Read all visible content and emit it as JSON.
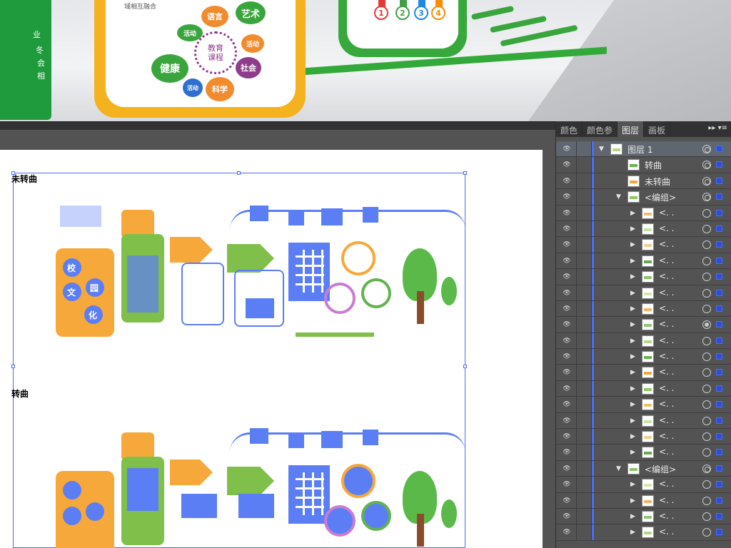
{
  "render": {
    "side_chars": [
      "业",
      "冬",
      "会",
      "相"
    ],
    "bubbles": {
      "center": "教育\n课程",
      "language": "语言",
      "art": "艺术",
      "activity_1": "活动",
      "activity_2": "活动",
      "activity_3": "活动",
      "health": "健康",
      "society": "社会",
      "science": "科学"
    },
    "panel_caption": "域相互融合",
    "numbers": [
      "1",
      "2",
      "3",
      "4"
    ]
  },
  "artboard": {
    "label_top": "未转曲",
    "label_bottom": "转曲",
    "badges": [
      "校",
      "园",
      "文",
      "化"
    ]
  },
  "layers_panel": {
    "tabs": [
      "颜色",
      "颜色参",
      "图层",
      "画板"
    ],
    "active_tab": "图层",
    "rows": [
      {
        "label": "图层  1",
        "indent": 1,
        "expander": "down",
        "highlight": true,
        "target": "dbl"
      },
      {
        "label": "转曲",
        "indent": 2,
        "expander": "",
        "target": "dbl"
      },
      {
        "label": "未转曲",
        "indent": 2,
        "expander": "",
        "target": "dbl"
      },
      {
        "label": "<编组>",
        "indent": 2,
        "expander": "down",
        "target": "dbl"
      },
      {
        "label": "<. .",
        "indent": 3,
        "expander": "right",
        "target": "single"
      },
      {
        "label": "<. .",
        "indent": 3,
        "expander": "right",
        "target": "single"
      },
      {
        "label": "<. .",
        "indent": 3,
        "expander": "right",
        "target": "single"
      },
      {
        "label": "<. .",
        "indent": 3,
        "expander": "right",
        "target": "single"
      },
      {
        "label": "<. .",
        "indent": 3,
        "expander": "right",
        "target": "single"
      },
      {
        "label": "<. .",
        "indent": 3,
        "expander": "right",
        "target": "single"
      },
      {
        "label": "<. .",
        "indent": 3,
        "expander": "right",
        "target": "single"
      },
      {
        "label": "<. .",
        "indent": 3,
        "expander": "right",
        "target": "filled"
      },
      {
        "label": "<. .",
        "indent": 3,
        "expander": "right",
        "target": "single"
      },
      {
        "label": "<. .",
        "indent": 3,
        "expander": "right",
        "target": "single"
      },
      {
        "label": "<. .",
        "indent": 3,
        "expander": "right",
        "target": "single"
      },
      {
        "label": "<. .",
        "indent": 3,
        "expander": "right",
        "target": "single"
      },
      {
        "label": "<. .",
        "indent": 3,
        "expander": "right",
        "target": "single"
      },
      {
        "label": "<. .",
        "indent": 3,
        "expander": "right",
        "target": "single"
      },
      {
        "label": "<. .",
        "indent": 3,
        "expander": "right",
        "target": "single"
      },
      {
        "label": "<. .",
        "indent": 3,
        "expander": "right",
        "target": "single"
      },
      {
        "label": "<编组>",
        "indent": 2,
        "expander": "down",
        "target": "dbl"
      },
      {
        "label": "<. .",
        "indent": 3,
        "expander": "right",
        "target": "single"
      },
      {
        "label": "<. .",
        "indent": 3,
        "expander": "right",
        "target": "single"
      },
      {
        "label": "<. .",
        "indent": 3,
        "expander": "right",
        "target": "single"
      },
      {
        "label": "<. .",
        "indent": 3,
        "expander": "right",
        "target": "single"
      }
    ],
    "thumb_colors": [
      "#b8d68a",
      "#6ab04c",
      "#f4a640",
      "#8fc760",
      "#e9c46a",
      "#c7e3a8",
      "#f2d091",
      "#6aa84f",
      "#8dc36b",
      "#d4e8b0",
      "#f6b26b",
      "#93c47d"
    ]
  }
}
